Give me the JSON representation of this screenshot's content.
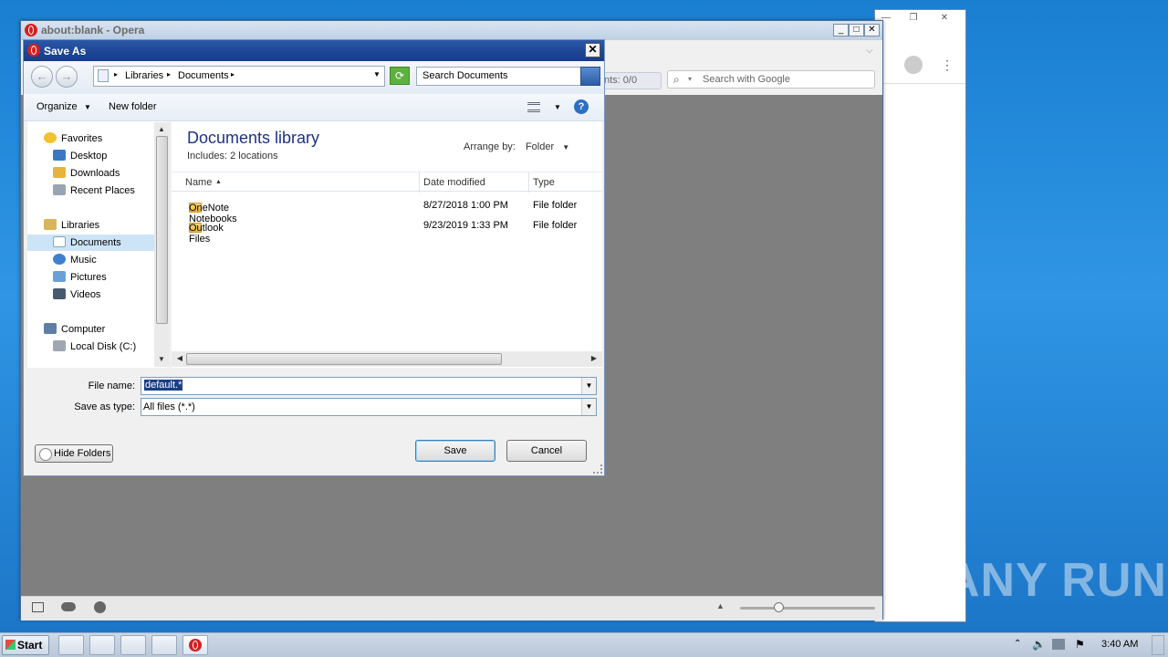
{
  "opera": {
    "title": "about:blank - Opera",
    "find_count": "nts:  0/0",
    "search_placeholder": "Search with Google"
  },
  "dialog": {
    "title": "Save As",
    "breadcrumb": [
      "Libraries",
      "Documents"
    ],
    "search_placeholder": "Search Documents",
    "organize_label": "Organize",
    "new_folder_label": "New folder",
    "nav": {
      "favorites": "Favorites",
      "desktop": "Desktop",
      "downloads": "Downloads",
      "recent_places": "Recent Places",
      "libraries": "Libraries",
      "documents": "Documents",
      "music": "Music",
      "pictures": "Pictures",
      "videos": "Videos",
      "computer": "Computer",
      "local_disk": "Local Disk (C:)"
    },
    "library_title": "Documents library",
    "includes_text": "Includes:  2 locations",
    "arrange_by_label": "Arrange by:",
    "arrange_by_value": "Folder",
    "columns": {
      "name": "Name",
      "date_modified": "Date modified",
      "type": "Type"
    },
    "rows": [
      {
        "name": "OneNote Notebooks",
        "date": "8/27/2018 1:00 PM",
        "type": "File folder"
      },
      {
        "name": "Outlook Files",
        "date": "9/23/2019 1:33 PM",
        "type": "File folder"
      }
    ],
    "file_name_label": "File name:",
    "file_name_value": "default.*",
    "save_as_type_label": "Save as type:",
    "save_as_type_value": "All files (*.*)",
    "hide_folders_label": "Hide Folders",
    "save_label": "Save",
    "cancel_label": "Cancel"
  },
  "taskbar": {
    "start_label": "Start",
    "clock": "3:40 AM"
  },
  "watermark": "ANY RUN",
  "colors": {
    "dialog_title_bar": "#1d4593",
    "selection": "#1b3e86",
    "library_title": "#1e3287",
    "desktop": "#1f84d6"
  }
}
